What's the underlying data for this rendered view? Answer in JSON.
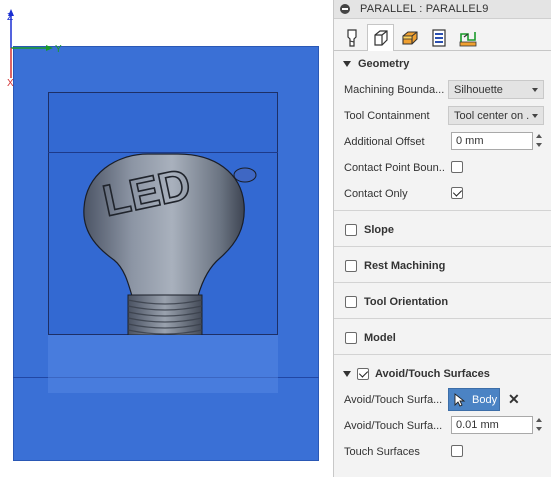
{
  "panel": {
    "title": "PARALLEL : PARALLEL9",
    "tabs": [
      {
        "icon": "tool-icon",
        "active": false
      },
      {
        "icon": "geometry-icon",
        "active": true
      },
      {
        "icon": "heights-icon",
        "active": false
      },
      {
        "icon": "passes-icon",
        "active": false
      },
      {
        "icon": "linking-icon",
        "active": false
      }
    ]
  },
  "geometry": {
    "heading": "Geometry",
    "machining_boundary_label": "Machining Bounda...",
    "machining_boundary_value": "Silhouette",
    "tool_containment_label": "Tool Containment",
    "tool_containment_value": "Tool center on ...",
    "additional_offset_label": "Additional Offset",
    "additional_offset_value": "0 mm",
    "contact_point_label": "Contact Point Boun...",
    "contact_point_checked": false,
    "contact_only_label": "Contact Only",
    "contact_only_checked": true
  },
  "sections": {
    "slope": "Slope",
    "rest_machining": "Rest Machining",
    "tool_orientation": "Tool Orientation",
    "model": "Model"
  },
  "avoid_touch": {
    "heading": "Avoid/Touch Surfaces",
    "checked": true,
    "surfaces_label": "Avoid/Touch Surfa...",
    "body_button_label": "Body",
    "clearance_label": "Avoid/Touch Surfa...",
    "clearance_value": "0.01 mm",
    "touch_surfaces_label": "Touch Surfaces",
    "touch_surfaces_checked": false
  },
  "viewport": {
    "axis_x_label": "Y",
    "axis_y_label": "Z",
    "axis_z_label": "X",
    "model_text": "LED"
  },
  "colors": {
    "stock_blue": "#3a70d6",
    "selection_blue": "#4b83c4",
    "panel_bg": "#f3f3f3"
  }
}
